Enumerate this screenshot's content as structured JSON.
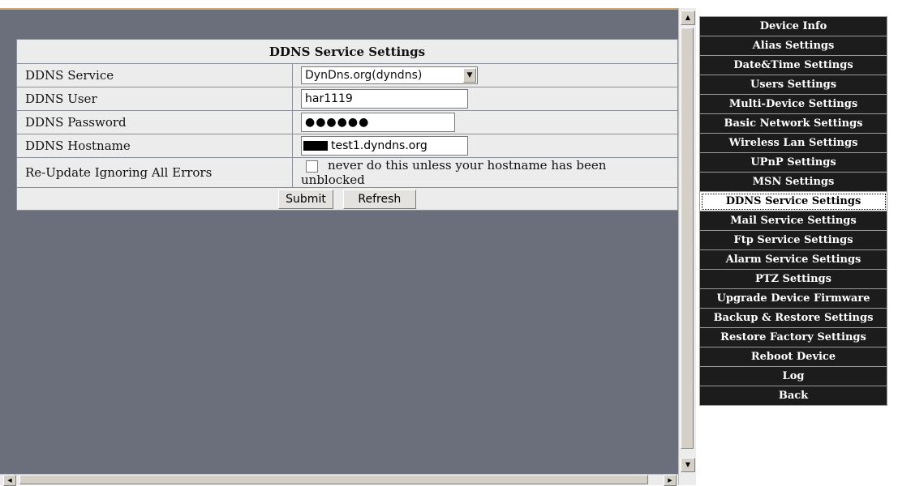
{
  "ddns": {
    "title": "DDNS Service Settings",
    "rows": {
      "service_label": "DDNS Service",
      "user_label": "DDNS User",
      "password_label": "DDNS Password",
      "hostname_label": "DDNS Hostname",
      "reupdate_label": "Re-Update Ignoring All Errors"
    },
    "service_value": "DynDns.org(dyndns)",
    "user_value": "har1119",
    "password_value": "●●●●●●",
    "hostname_value": "test1.dyndns.org",
    "reupdate_checked": false,
    "reupdate_note": "never do this unless your hostname has been unblocked",
    "submit_label": "Submit",
    "refresh_label": "Refresh"
  },
  "nav": {
    "items": [
      {
        "label": "Device Info"
      },
      {
        "label": "Alias Settings"
      },
      {
        "label": "Date&Time Settings"
      },
      {
        "label": "Users Settings"
      },
      {
        "label": "Multi-Device Settings"
      },
      {
        "label": "Basic Network Settings"
      },
      {
        "label": "Wireless Lan Settings"
      },
      {
        "label": "UPnP Settings"
      },
      {
        "label": "MSN Settings"
      },
      {
        "label": "DDNS Service Settings",
        "active": true
      },
      {
        "label": "Mail Service Settings"
      },
      {
        "label": "Ftp Service Settings"
      },
      {
        "label": "Alarm Service Settings"
      },
      {
        "label": "PTZ Settings"
      },
      {
        "label": "Upgrade Device Firmware"
      },
      {
        "label": "Backup & Restore Settings"
      },
      {
        "label": "Restore Factory Settings"
      },
      {
        "label": "Reboot Device"
      },
      {
        "label": "Log"
      },
      {
        "label": "Back"
      }
    ]
  },
  "icons": {
    "scroll_up": "scroll-up-arrow-icon",
    "scroll_down": "scroll-down-arrow-icon",
    "scroll_left": "scroll-left-arrow-icon",
    "scroll_right": "scroll-right-arrow-icon",
    "dropdown": "chevron-down-icon"
  },
  "colors": {
    "content_bg": "#6b6f7b",
    "table_bg": "#ececec",
    "nav_bg": "#1c1c1c",
    "nav_active_bg": "#ffffff"
  }
}
